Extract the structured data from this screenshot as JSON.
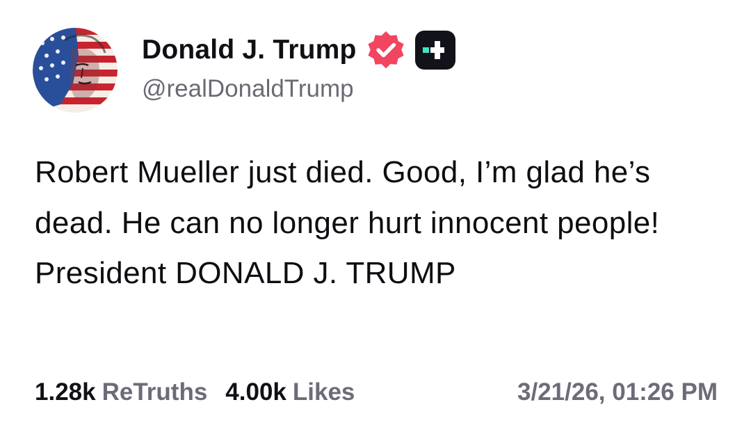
{
  "post": {
    "author": {
      "display_name": "Donald J. Trump",
      "handle": "@realDonaldTrump",
      "avatar_icon": "flag-portrait-avatar",
      "verified_icon": "verified-badge-icon",
      "app_icon": "truth-social-logo-icon"
    },
    "text": "Robert Mueller just died. Good, I’m glad he’s dead. He can no longer hurt innocent people! President DONALD J. TRUMP",
    "stats": {
      "retruths_count": "1.28k",
      "retruths_label": "ReTruths",
      "likes_count": "4.00k",
      "likes_label": "Likes"
    },
    "timestamp": "3/21/26, 01:26 PM"
  },
  "colors": {
    "text": "#0d0d12",
    "muted": "#6c6c78",
    "verified": "#f2455f",
    "app_badge_bg": "#12121a",
    "app_badge_accent": "#3ee6c7"
  }
}
